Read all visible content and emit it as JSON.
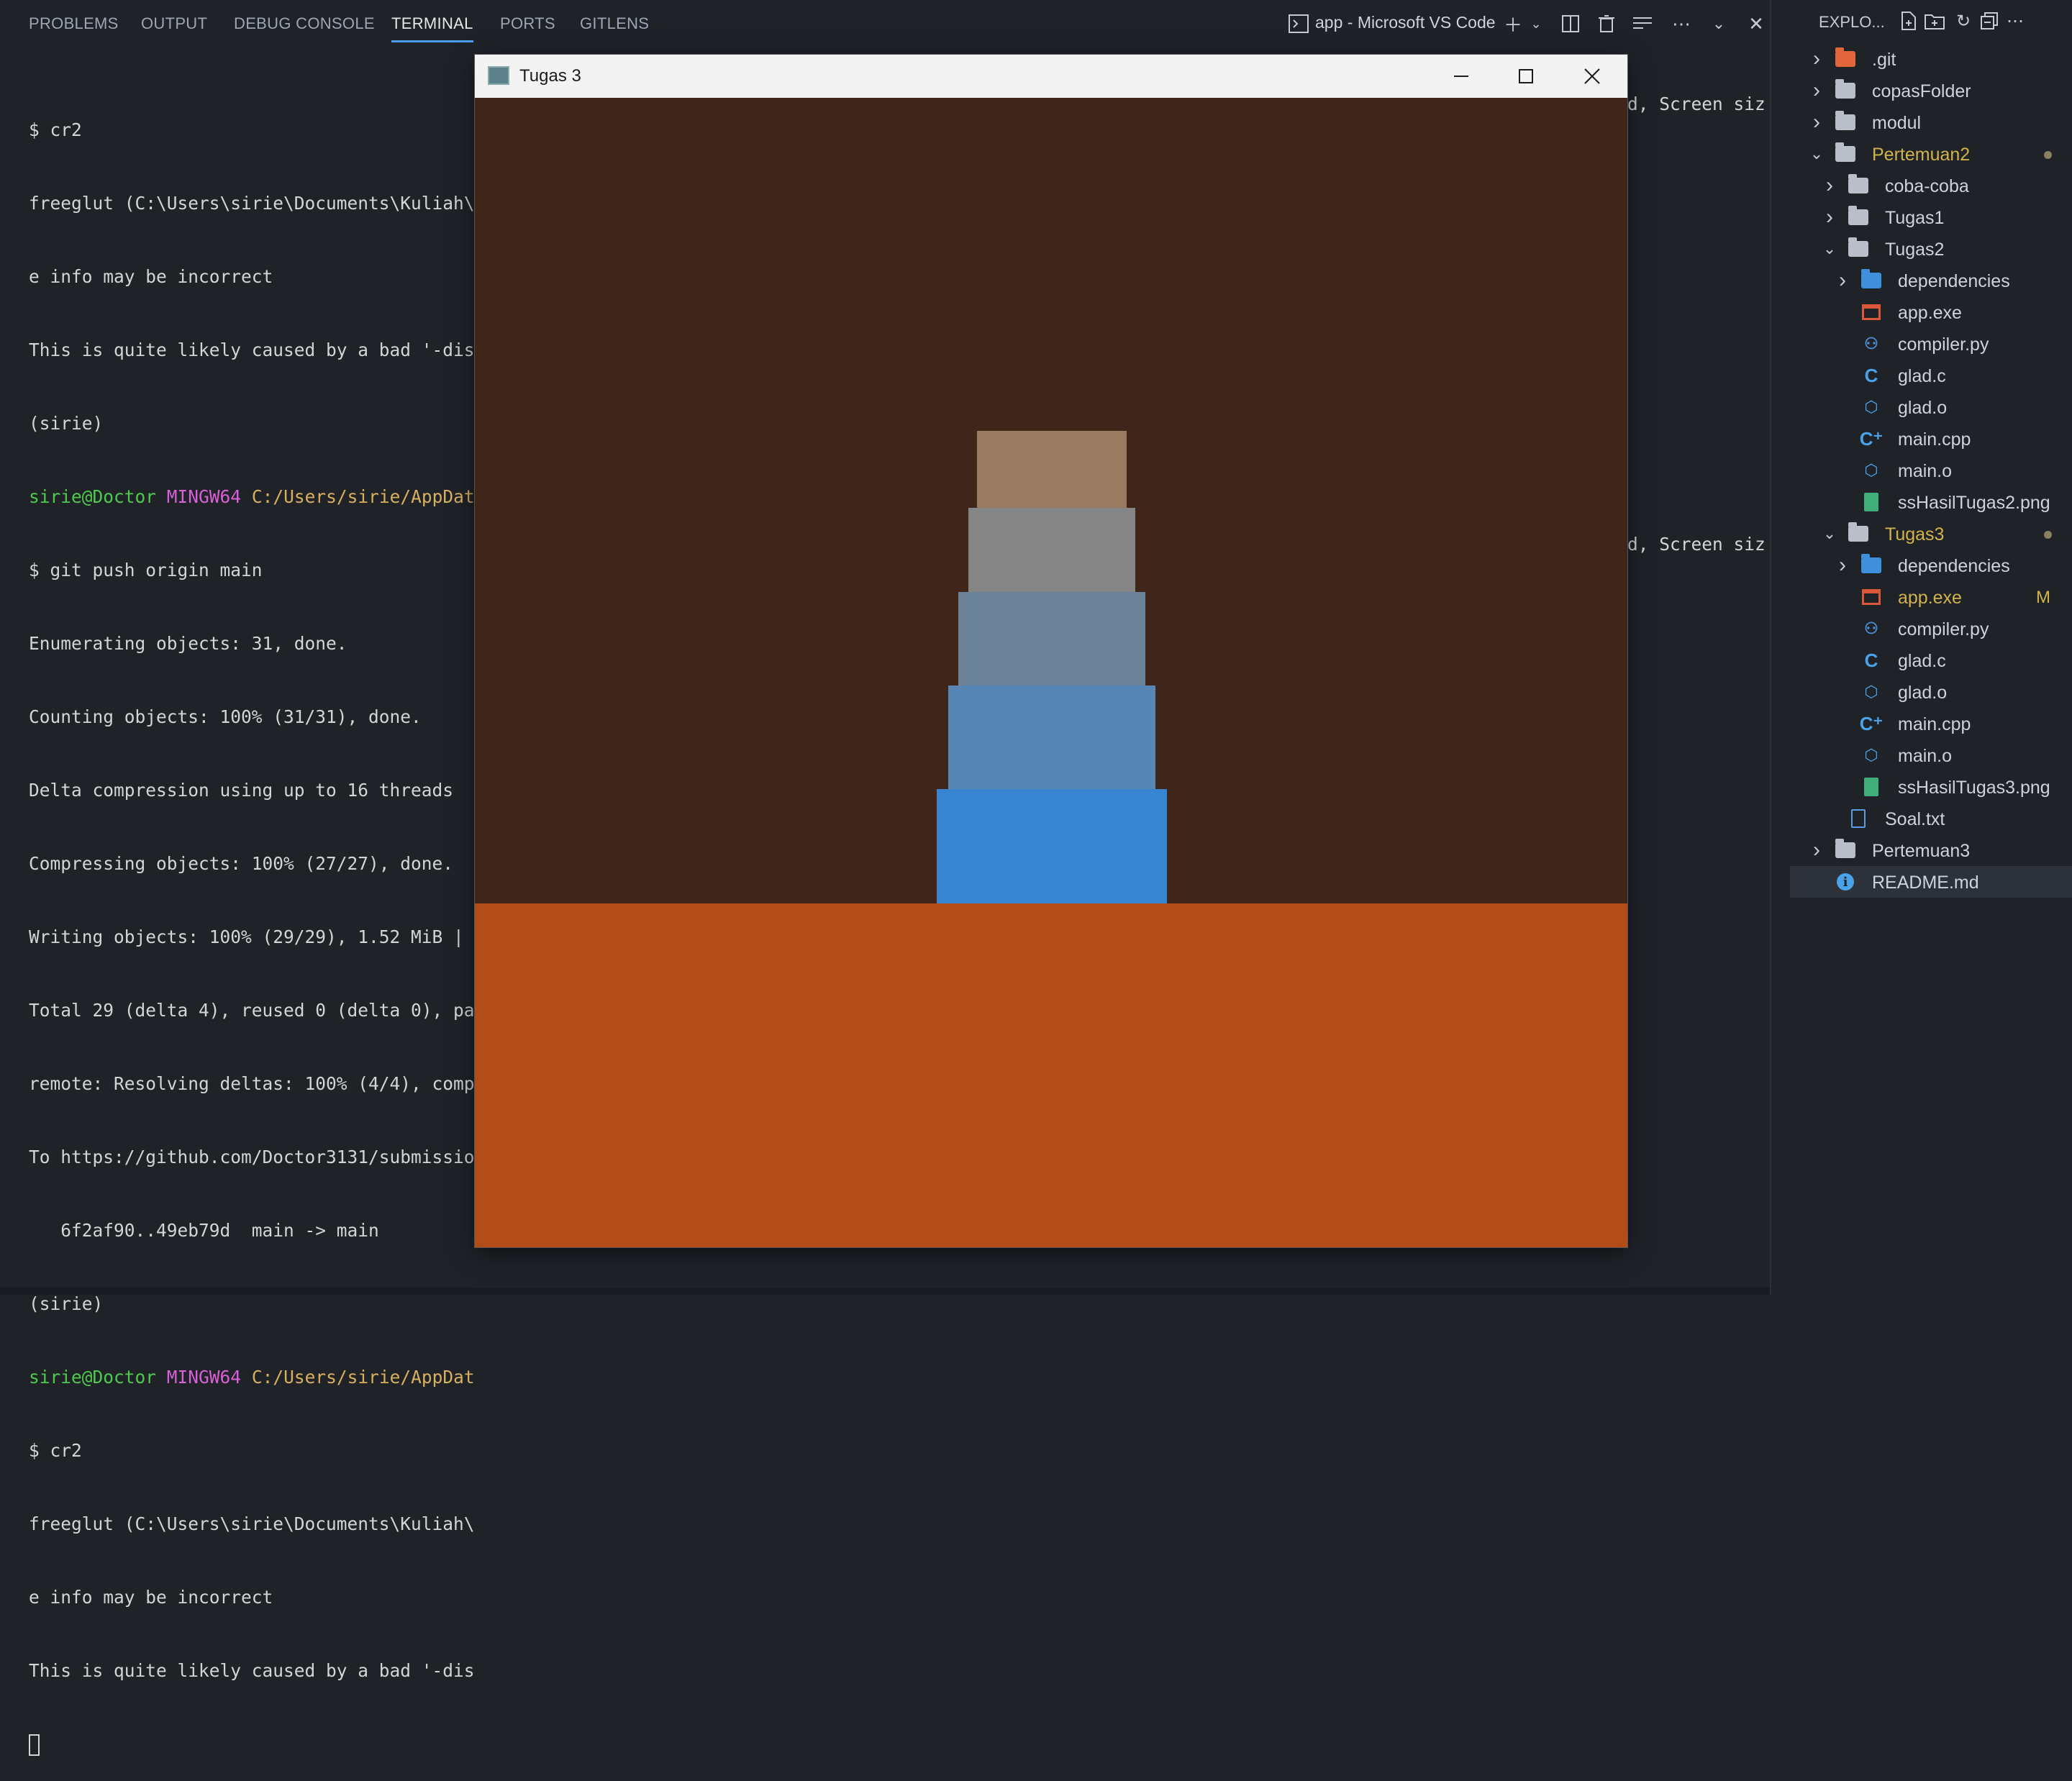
{
  "panel": {
    "tabs": [
      "PROBLEMS",
      "OUTPUT",
      "DEBUG CONSOLE",
      "TERMINAL",
      "PORTS",
      "GITLENS"
    ],
    "active_tab": "TERMINAL",
    "terminal_title": "app - Microsoft VS Code",
    "icons": [
      "terminal-icon",
      "plus-icon",
      "chevron-down-icon",
      "split-icon",
      "trash-icon",
      "clear-icon",
      "more-icon",
      "chevron-down-icon",
      "close-icon"
    ]
  },
  "terminal": {
    "lines": [
      "$ cr2",
      "freeglut (C:\\Users\\sirie\\Documents\\Kuliah\\",
      "e info may be incorrect",
      "This is quite likely caused by a bad '-dis",
      "(sirie)",
      "",
      "$ git push origin main",
      "Enumerating objects: 31, done.",
      "Counting objects: 100% (31/31), done.",
      "Delta compression using up to 16 threads",
      "Compressing objects: 100% (27/27), done.",
      "Writing objects: 100% (29/29), 1.52 MiB |",
      "Total 29 (delta 4), reused 0 (delta 0), pa",
      "remote: Resolving deltas: 100% (4/4), comp",
      "To https://github.com/Doctor3131/submissio",
      "   6f2af90..49eb79d  main -> main",
      "(sirie)",
      "",
      "$ cr2",
      "freeglut (C:\\Users\\sirie\\Documents\\Kuliah\\",
      "e info may be incorrect",
      "This is quite likely caused by a bad '-dis"
    ],
    "prompt_user": "sirie@Doctor",
    "prompt_host": "MINGW64",
    "prompt_path": "C:/Users/sirie/AppDat",
    "right_fragment": "d, Screen siz"
  },
  "explorer": {
    "title": "EXPLO...",
    "items": [
      {
        "label": ".git",
        "kind": "folder-git",
        "level": 0,
        "chevron": "right"
      },
      {
        "label": "copasFolder",
        "kind": "folder",
        "level": 0,
        "chevron": "right"
      },
      {
        "label": "modul",
        "kind": "folder",
        "level": 0,
        "chevron": "right"
      },
      {
        "label": "Pertemuan2",
        "kind": "folder-open",
        "level": 0,
        "chevron": "down",
        "color": "#d2b24c",
        "dot": true
      },
      {
        "label": "coba-coba",
        "kind": "folder",
        "level": 1,
        "chevron": "right"
      },
      {
        "label": "Tugas1",
        "kind": "folder",
        "level": 1,
        "chevron": "right"
      },
      {
        "label": "Tugas2",
        "kind": "folder-open",
        "level": 1,
        "chevron": "down"
      },
      {
        "label": "dependencies",
        "kind": "folder-dep",
        "level": 2,
        "chevron": "right"
      },
      {
        "label": "app.exe",
        "kind": "exe",
        "level": 2
      },
      {
        "label": "compiler.py",
        "kind": "py",
        "level": 2
      },
      {
        "label": "glad.c",
        "kind": "c",
        "level": 2
      },
      {
        "label": "glad.o",
        "kind": "o",
        "level": 2
      },
      {
        "label": "main.cpp",
        "kind": "cpp",
        "level": 2
      },
      {
        "label": "main.o",
        "kind": "o",
        "level": 2
      },
      {
        "label": "ssHasilTugas2.png",
        "kind": "png",
        "level": 2
      },
      {
        "label": "Tugas3",
        "kind": "folder-open",
        "level": 1,
        "chevron": "down",
        "color": "#d2b24c",
        "dot": true
      },
      {
        "label": "dependencies",
        "kind": "folder-dep",
        "level": 2,
        "chevron": "right"
      },
      {
        "label": "app.exe",
        "kind": "exe",
        "level": 2,
        "color": "#d2b24c",
        "badge": "M"
      },
      {
        "label": "compiler.py",
        "kind": "py",
        "level": 2
      },
      {
        "label": "glad.c",
        "kind": "c",
        "level": 2
      },
      {
        "label": "glad.o",
        "kind": "o",
        "level": 2
      },
      {
        "label": "main.cpp",
        "kind": "cpp",
        "level": 2
      },
      {
        "label": "main.o",
        "kind": "o",
        "level": 2
      },
      {
        "label": "ssHasilTugas3.png",
        "kind": "png",
        "level": 2
      },
      {
        "label": "Soal.txt",
        "kind": "txt",
        "level": 1
      },
      {
        "label": "Pertemuan3",
        "kind": "folder",
        "level": 0,
        "chevron": "right"
      },
      {
        "label": "README.md",
        "kind": "info",
        "level": 0,
        "selected": true
      }
    ]
  },
  "app_window": {
    "title": "Tugas 3",
    "background": "#3f251a",
    "ground_color": "#b24d17",
    "blocks": [
      {
        "color": "#9a7b62"
      },
      {
        "color": "#858585"
      },
      {
        "color": "#6b8299"
      },
      {
        "color": "#5786b5"
      },
      {
        "color": "#3784d1"
      }
    ]
  }
}
